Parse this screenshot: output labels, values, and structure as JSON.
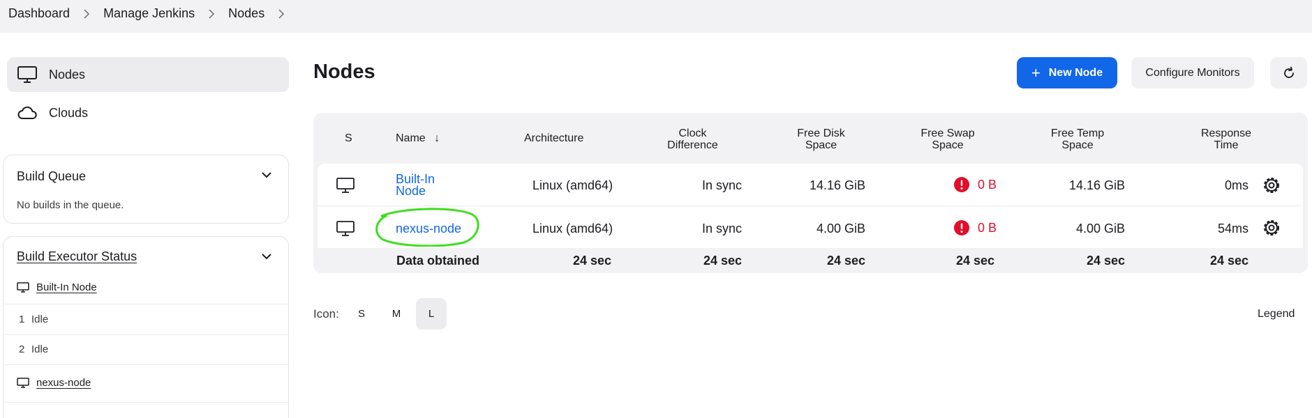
{
  "breadcrumb": [
    "Dashboard",
    "Manage Jenkins",
    "Nodes"
  ],
  "sidebar": {
    "items": [
      {
        "label": "Nodes",
        "icon": "computer-icon",
        "active": true
      },
      {
        "label": "Clouds",
        "icon": "cloud-icon",
        "active": false
      }
    ],
    "build_queue": {
      "title": "Build Queue",
      "empty_text": "No builds in the queue."
    },
    "executor_status": {
      "title": "Build Executor Status",
      "nodes": [
        {
          "name": "Built-In Node",
          "executors": [
            {
              "num": "1",
              "status": "Idle"
            },
            {
              "num": "2",
              "status": "Idle"
            }
          ]
        },
        {
          "name": "nexus-node",
          "executors": []
        }
      ]
    }
  },
  "main": {
    "title": "Nodes",
    "new_node_label": "New Node",
    "configure_monitors_label": "Configure Monitors",
    "table": {
      "headers": {
        "s": "S",
        "name": "Name",
        "sort_arrow": "↓",
        "architecture": "Architecture",
        "clock_1": "Clock",
        "clock_2": "Difference",
        "disk_1": "Free Disk",
        "disk_2": "Space",
        "swap_1": "Free Swap",
        "swap_2": "Space",
        "temp_1": "Free Temp",
        "temp_2": "Space",
        "resp_1": "Response",
        "resp_2": "Time"
      },
      "rows": [
        {
          "name_1": "Built-In",
          "name_2": "Node",
          "architecture": "Linux (amd64)",
          "clock": "In sync",
          "disk": "14.16 GiB",
          "swap": "0 B",
          "temp": "14.16 GiB",
          "response": "0ms"
        },
        {
          "name": "nexus-node",
          "architecture": "Linux (amd64)",
          "clock": "In sync",
          "disk": "4.00 GiB",
          "swap": "0 B",
          "temp": "4.00 GiB",
          "response": "54ms"
        }
      ],
      "footer": {
        "label": "Data obtained",
        "values": [
          "24 sec",
          "24 sec",
          "24 sec",
          "24 sec",
          "24 sec",
          "24 sec"
        ]
      }
    },
    "icon_label": "Icon:",
    "icon_sizes": [
      "S",
      "M",
      "L"
    ],
    "icon_size_selected": "L",
    "legend_label": "Legend"
  },
  "colors": {
    "accent": "#1167e8",
    "error": "#e0102a",
    "highlight": "#3dde1e"
  }
}
